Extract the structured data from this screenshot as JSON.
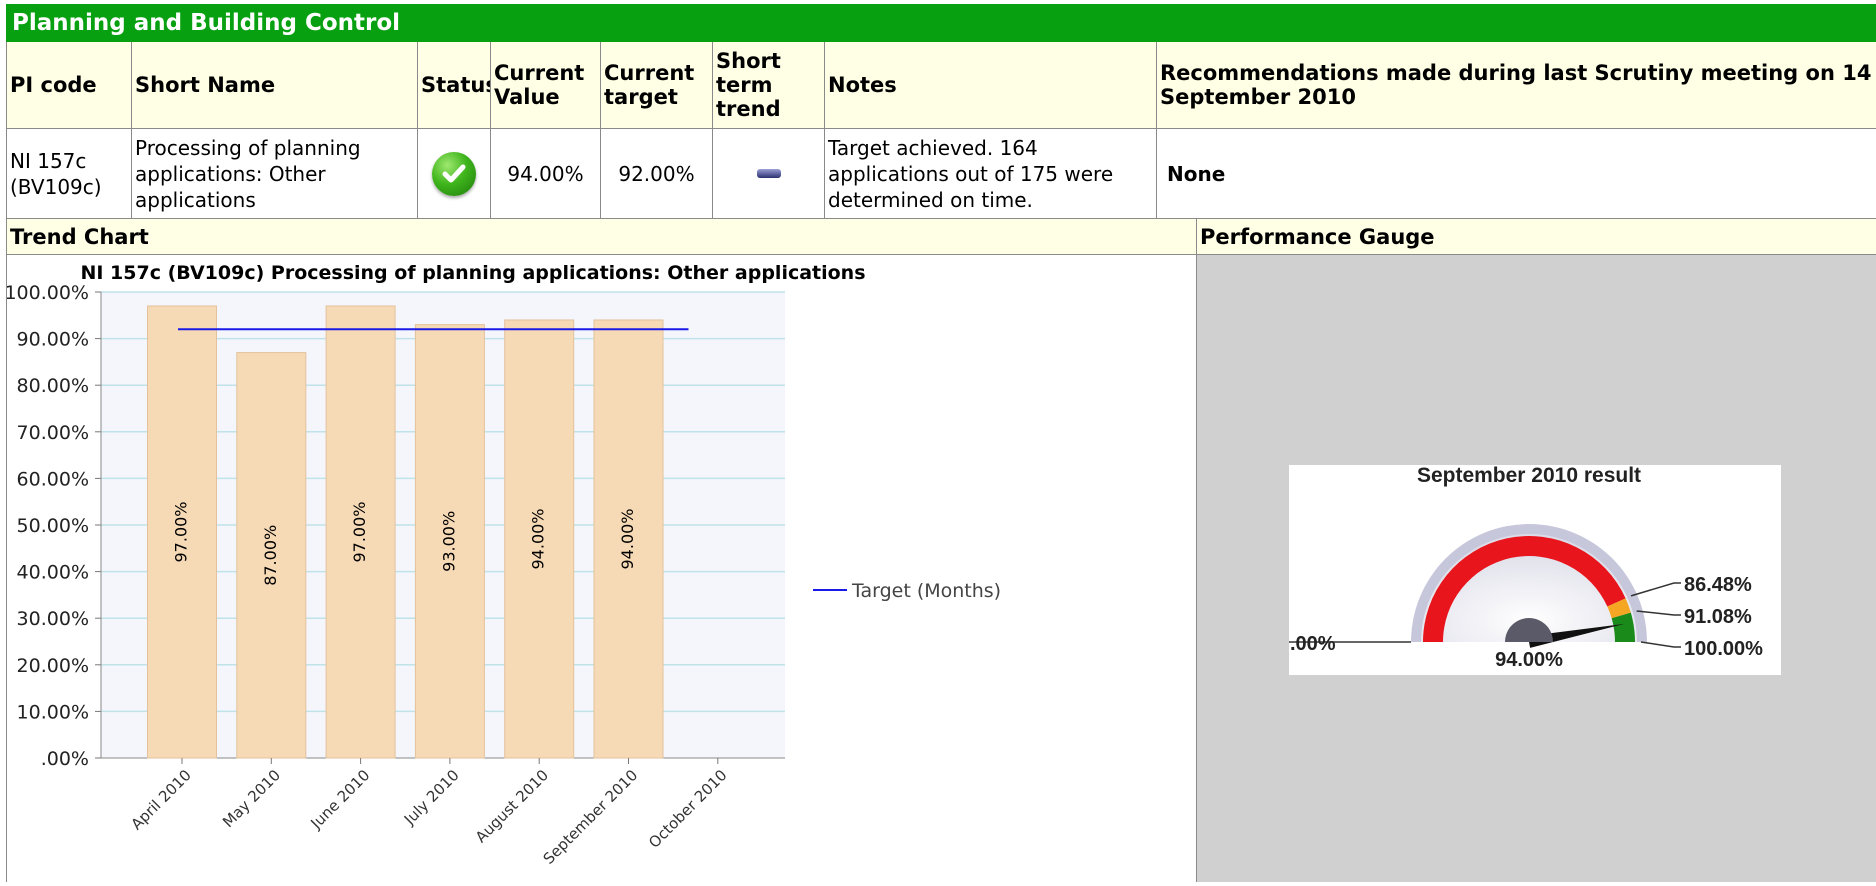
{
  "section": {
    "title": "Planning and Building Control"
  },
  "table": {
    "headers": {
      "pi_code": "PI code",
      "short_name": "Short Name",
      "status": "Status",
      "current_value": "Current Value",
      "current_target": "Current target",
      "short_term_trend": "Short term trend",
      "notes": "Notes",
      "recommendations": "Recommendations made during last Scrutiny meeting on 14 September 2010"
    },
    "row": {
      "pi_code": "NI 157c (BV109c)",
      "short_name": "Processing of planning applications: Other applications",
      "status_icon": "green-check-icon",
      "current_value": "94.00%",
      "current_target": "92.00%",
      "trend_icon": "dash-trend-icon",
      "notes": "Target achieved. 164 applications out of 175 were determined on time.",
      "recommendations": "None"
    }
  },
  "panels": {
    "trend_chart": "Trend Chart",
    "performance_gauge": "Performance Gauge"
  },
  "chart_data": [
    {
      "type": "bar",
      "title": "NI 157c (BV109c) Processing of planning applications: Other applications",
      "categories": [
        "April 2010",
        "May 2010",
        "June 2010",
        "July 2010",
        "August 2010",
        "September 2010",
        "October 2010"
      ],
      "values": [
        97,
        87,
        97,
        93,
        94,
        94,
        null
      ],
      "data_labels": [
        "97.00%",
        "87.00%",
        "97.00%",
        "93.00%",
        "94.00%",
        "94.00%",
        ""
      ],
      "yticks": [
        "100.00%",
        "90.00%",
        "80.00%",
        "70.00%",
        "60.00%",
        "50.00%",
        "40.00%",
        "30.00%",
        "20.00%",
        "10.00%",
        ".00%"
      ],
      "ylim": [
        0,
        100
      ],
      "target_line": {
        "name": "Target (Months)",
        "value": 92,
        "color": "#1a1ae6"
      },
      "bar_color": "#f6d9b5",
      "grid": true,
      "legend": "right"
    },
    {
      "type": "gauge",
      "title": "September 2010 result",
      "value": 94,
      "value_label": "94.00%",
      "min_label": ".00%",
      "thresholds": [
        {
          "label": "86.48%",
          "value": 86.48
        },
        {
          "label": "91.08%",
          "value": 91.08
        },
        {
          "label": "100.00%",
          "value": 100
        }
      ],
      "colors": {
        "red": "#e8151c",
        "amber": "#f5a623",
        "green": "#1a8a1a"
      }
    }
  ],
  "colors": {
    "title_bar": "#07a010",
    "header_bg": "#ffffe6",
    "gauge_bg": "#d0d0d0"
  }
}
